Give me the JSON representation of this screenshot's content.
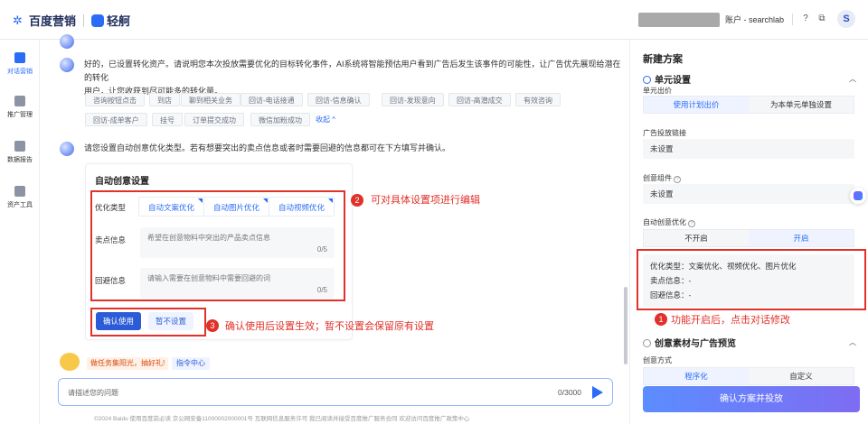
{
  "topbar": {
    "brand1": "百度营销",
    "brand2": "轻舸",
    "account": "账户 - searchlab",
    "avatar": "S",
    "icons": [
      "help-icon",
      "copy-icon"
    ]
  },
  "leftnav": [
    {
      "label": "对话营销",
      "icon": "chat-marketing-icon",
      "active": true
    },
    {
      "label": "推广管理",
      "icon": "chart-icon",
      "active": false
    },
    {
      "label": "数据报告",
      "icon": "report-icon",
      "active": false
    },
    {
      "label": "资产工具",
      "icon": "toolbox-icon",
      "active": false
    }
  ],
  "chat": {
    "msg1": "好的，已设置转化资产。请说明您本次投放需要优化的目标转化事件，AI系统将智能预估用户看到广告后发生该事件的可能性，让广告优先展现给潜在的转化",
    "msg1b": "用户，让您收获到尽可能多的转化量。",
    "chips_row1": [
      "咨询按钮点击",
      "到店",
      "聊到相关业务",
      "回访-电话接通",
      "回访-信息确认",
      "回访-发现意向",
      "回访-高潜成交",
      "有效咨询"
    ],
    "chips_row2": [
      "回访-成单客户",
      "挂号",
      "订单提交成功",
      "微信加粉成功"
    ],
    "collapse": "收起 ^",
    "msg2": "请您设置自动创意优化类型。若有想要突出的卖点信息或者时需要回避的信息都可在下方填写并确认。",
    "card": {
      "title": "自动创意设置",
      "opt_label": "优化类型",
      "tabs": [
        "自动文案优化",
        "自动图片优化",
        "自动视频优化"
      ],
      "sell_label": "卖点信息",
      "sell_placeholder": "希望在创意物料中突出的产品卖点信息",
      "sell_count": "0/5",
      "avoid_label": "回避信息",
      "avoid_placeholder": "请输入需要在创意物料中需要回避的词",
      "avoid_count": "0/5",
      "confirm": "确认使用",
      "skip": "暂不设置"
    },
    "promo": "做任务集阳光，抽好礼!",
    "cmd": "指令中心",
    "input_placeholder": "请描述您的问题",
    "input_count": "0/3000",
    "footer": "©2024 Baidu 使用百度前必读 京公网安备11000002000001号 互联网信息服务许可 我已阅读并接受百度推广服务合同 欢迎访问百度推广政策中心"
  },
  "annotations": {
    "n1": "1",
    "t1": "功能开启后，点击对话修改",
    "n2": "2",
    "t2": "可对具体设置项进行编辑",
    "n3": "3",
    "t3": "确认使用后设置生效；暂不设置会保留原有设置"
  },
  "panel": {
    "title": "新建方案",
    "sec1": "单元设置",
    "bid_label": "单元出价",
    "bid_opts": [
      "使用计划出价",
      "为本单元单独设置"
    ],
    "link_label": "广告投放链接",
    "link_value": "未设置",
    "comp_label": "创意组件",
    "comp_value": "未设置",
    "auto_label": "自动创意优化",
    "auto_opts": [
      "不开启",
      "开启"
    ],
    "summary": [
      "优化类型：文案优化、视频优化、图片优化",
      "卖点信息：-",
      "回避信息：-"
    ],
    "sec2": "创意素材与广告预览",
    "method_label": "创意方式",
    "method_opts": [
      "程序化",
      "自定义"
    ],
    "confirm_btn": "确认方案并投放"
  },
  "colors": {
    "accent": "#2b6cf6",
    "annotation": "#e0312a"
  }
}
